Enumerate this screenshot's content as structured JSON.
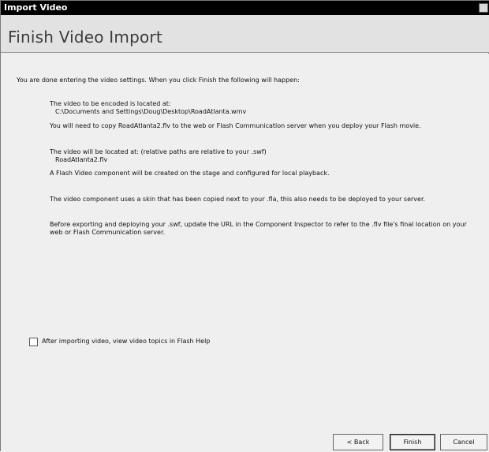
{
  "window": {
    "title": "Import Video"
  },
  "header": {
    "heading": "Finish Video Import"
  },
  "content": {
    "intro": "You are done entering the video settings. When you click Finish the following will happen:",
    "items": [
      {
        "text": "The video to be encoded is located at:",
        "sub": "C:\\Documents and Settings\\Doug\\Desktop\\RoadAtlanta.wmv"
      },
      {
        "text": "You will need to copy RoadAtlanta2.flv to the web or Flash Communication server when you deploy your Flash movie."
      },
      {
        "text": "The video will be located at: (relative paths are relative to your .swf)",
        "sub": "RoadAtlanta2.flv"
      },
      {
        "text": "A Flash Video component will be created on the stage and configured for local playback."
      },
      {
        "text": "The video component uses a skin that has been copied next to your .fla, this also needs to be deployed to your server."
      },
      {
        "text": "Before exporting and deploying your .swf, update the URL in the Component Inspector to refer to the .flv file's final location on your web or Flash Communication server."
      }
    ],
    "checkbox_label": "After importing video, view video topics in Flash Help",
    "checkbox_checked": false
  },
  "buttons": {
    "back": "< Back",
    "finish": "Finish",
    "cancel": "Cancel"
  }
}
